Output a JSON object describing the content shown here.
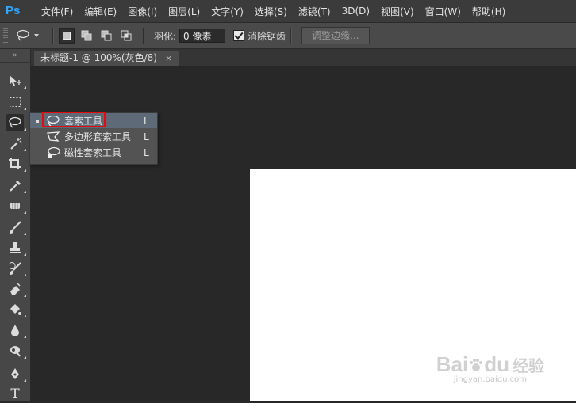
{
  "app": {
    "logo": "Ps"
  },
  "menu": [
    "文件(F)",
    "编辑(E)",
    "图像(I)",
    "图层(L)",
    "文字(Y)",
    "选择(S)",
    "滤镜(T)",
    "3D(D)",
    "视图(V)",
    "窗口(W)",
    "帮助(H)"
  ],
  "options": {
    "feather_label": "羽化:",
    "feather_value": "0 像素",
    "antialias_label": "消除锯齿",
    "antialias_checked": true,
    "refine_edge_label": "调整边缘..."
  },
  "tab": {
    "title": "未标题-1 @ 100%(灰色/8)",
    "close": "×"
  },
  "toolbox": {
    "collapse": "»",
    "tools": [
      "move-tool",
      "marquee-tool",
      "lasso-tool",
      "magic-wand-tool",
      "crop-tool",
      "eyedropper-tool",
      "healing-brush-tool",
      "brush-tool",
      "clone-stamp-tool",
      "history-brush-tool",
      "eraser-tool",
      "paint-bucket-tool",
      "blur-tool",
      "dodge-tool",
      "pen-tool",
      "type-tool"
    ],
    "type_glyph": "T"
  },
  "flyout": {
    "items": [
      {
        "label": "套索工具",
        "key": "L",
        "active": true
      },
      {
        "label": "多边形套索工具",
        "key": "L",
        "active": false
      },
      {
        "label": "磁性套索工具",
        "key": "L",
        "active": false
      }
    ]
  },
  "watermark": {
    "brand": "Bai",
    "brand2": "du",
    "cn": "经验",
    "url": "jingyan.baidu.com"
  },
  "colors": {
    "accent": "#31a8ff",
    "highlight_box": "#e30b0b",
    "canvas": "#282828",
    "document": "#ffffff"
  }
}
